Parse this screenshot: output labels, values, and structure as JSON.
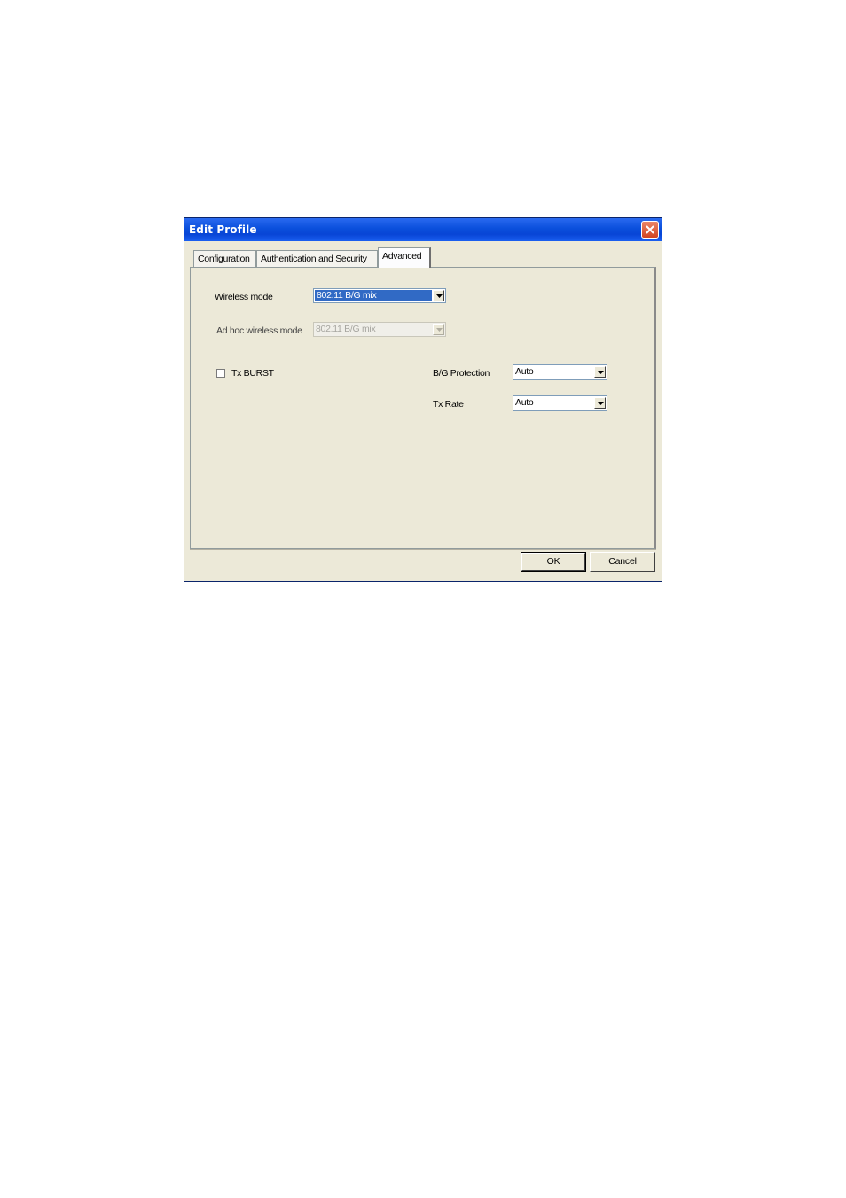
{
  "window": {
    "title": "Edit Profile"
  },
  "tabs": [
    {
      "label": "Configuration",
      "active": false
    },
    {
      "label": "Authentication and Security",
      "active": false
    },
    {
      "label": "Advanced",
      "active": true
    }
  ],
  "advanced": {
    "wireless_mode": {
      "label": "Wireless mode",
      "value": "802.11 B/G mix"
    },
    "adhoc_mode": {
      "label": "Ad hoc wireless mode",
      "value": "802.11 B/G mix",
      "disabled": true
    },
    "tx_burst": {
      "label": "Tx BURST",
      "checked": false
    },
    "bg_protection": {
      "label": "B/G Protection",
      "value": "Auto"
    },
    "tx_rate": {
      "label": "Tx Rate",
      "value": "Auto"
    }
  },
  "buttons": {
    "ok": "OK",
    "cancel": "Cancel"
  },
  "colors": {
    "title_bar": "#0a4fdc",
    "close_button": "#d2441f",
    "dialog_bg": "#ece9d8",
    "selection": "#316ac5"
  },
  "icons": {
    "close": "close-icon",
    "dropdown": "chevron-down-icon"
  }
}
